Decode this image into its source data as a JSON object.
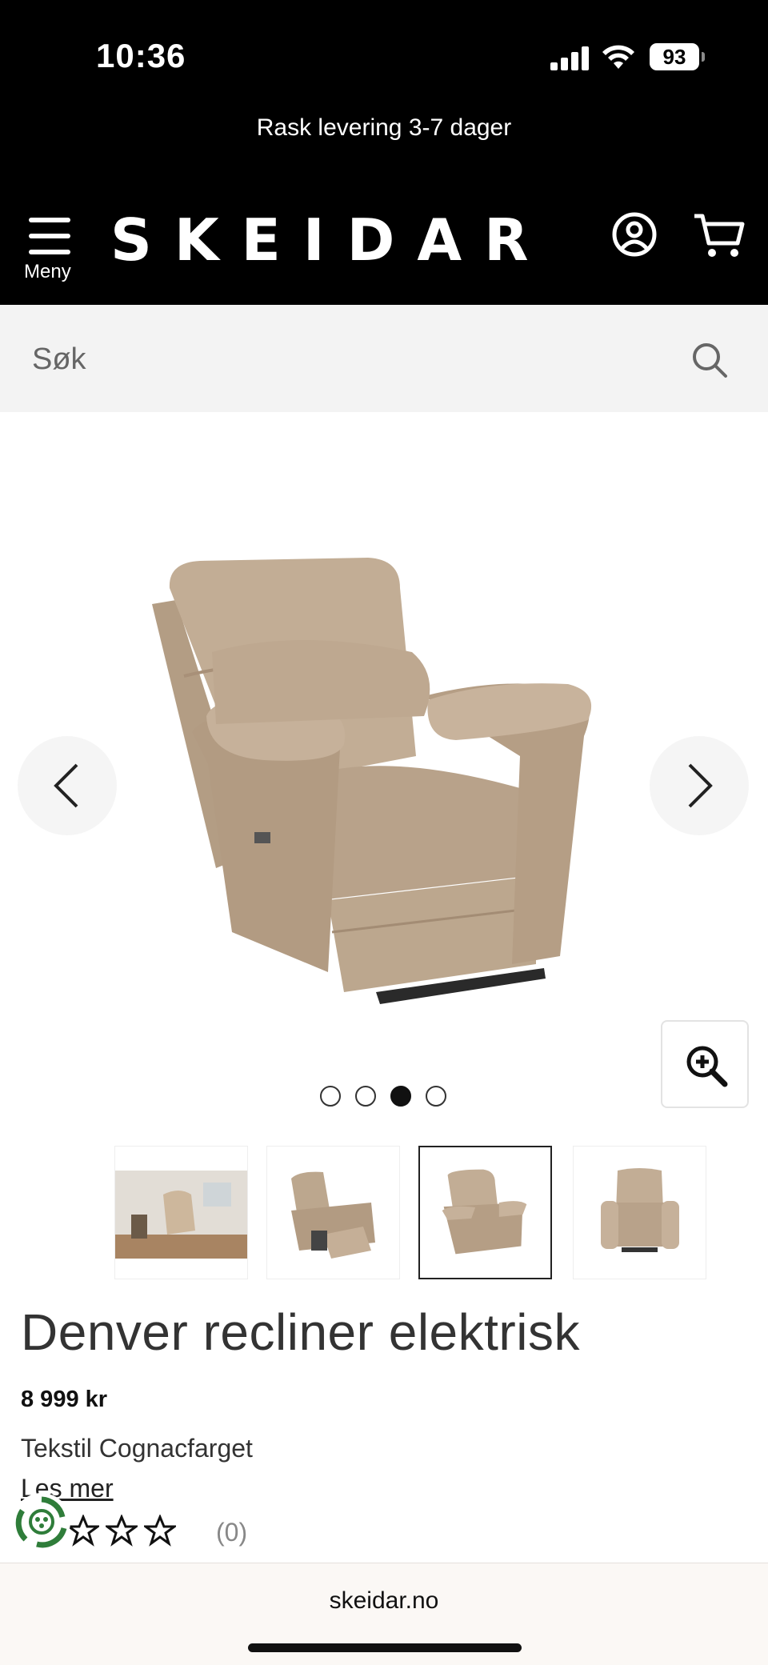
{
  "status": {
    "time": "10:36",
    "battery": "93"
  },
  "promo": {
    "text": "Rask levering 3-7 dager"
  },
  "header": {
    "menu_label": "Meny",
    "logo": "SKEIDAR"
  },
  "search": {
    "placeholder": "Søk"
  },
  "gallery": {
    "total_images": 4,
    "active_index": 3
  },
  "product": {
    "title": "Denver recliner elektrisk",
    "price": "8 999 kr",
    "variant": "Tekstil Cognacfarget",
    "read_more": "Les mer",
    "rating_stars": 0,
    "rating_count": "(0)"
  },
  "browser": {
    "url": "skeidar.no"
  },
  "colors": {
    "header_bg": "#000000",
    "upholstery": "#bfa98f",
    "search_bg": "#f3f3f3"
  },
  "icons": [
    "signal-icon",
    "wifi-icon",
    "menu-icon",
    "account-icon",
    "cart-icon",
    "search-icon",
    "chevron-left-icon",
    "chevron-right-icon",
    "zoom-in-icon",
    "star-icon",
    "eco-recycle-icon"
  ]
}
